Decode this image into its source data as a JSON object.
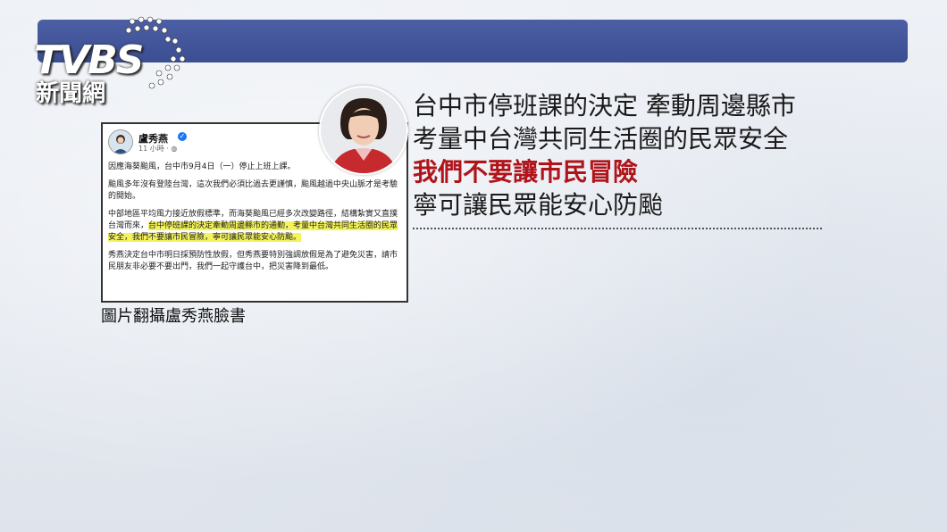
{
  "logo": {
    "main": "TVBS",
    "sub": "新聞網"
  },
  "post": {
    "author": "盧秀燕",
    "time": "11 小時 · ",
    "paragraphs": [
      {
        "text": "因應海葵颱風，台中市9月4日（一）停止上班上課。"
      },
      {
        "text": "颱風多年沒有登陸台灣，這次我們必須比過去更謹慎，颱風越過中央山脈才是考驗的開始。"
      },
      {
        "before": "中部地區平均風力接近放假標準，而海葵颱風已經多次改變路徑，結構紮實又直撲台灣而來，",
        "highlight": "台中停班課的決定牽動周邊縣市的通勤，考量中台灣共同生活圈的民眾安全，我們不要讓市民冒險，寧可讓民眾能安心防颱。",
        "after": ""
      },
      {
        "text": "秀燕決定台中市明日採預防性放假，但秀燕要特別強調放假是為了避免災害，請市民朋友非必要不要出門，我們一起守護台中，把災害降到最低。"
      }
    ]
  },
  "caption": "圖片翻攝盧秀燕臉書",
  "quote": {
    "line1": "台中市停班課的決定 牽動周邊縣市",
    "line2": "考量中台灣共同生活圈的民眾安全",
    "line3": "我們不要讓市民冒險",
    "line4": "寧可讓民眾能安心防颱"
  },
  "colors": {
    "bar": "#3b4e92",
    "emphasis": "#b0141b",
    "highlight": "#f4f35a"
  }
}
